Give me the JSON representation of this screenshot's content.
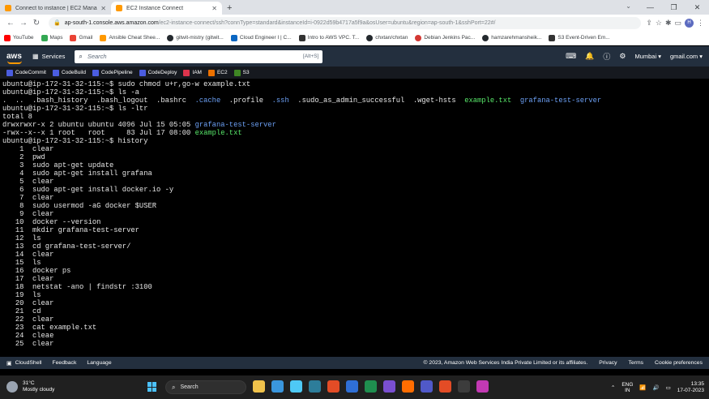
{
  "browser": {
    "tabs": [
      {
        "title": "Connect to instance | EC2 Manag",
        "color": "#ff9900",
        "active": false
      },
      {
        "title": "EC2 Instance Connect",
        "color": "#ff9900",
        "active": true
      }
    ],
    "url_host": "ap-south-1.console.aws.amazon.com",
    "url_path": "/ec2-instance-connect/ssh?connType=standard&instanceId=i-0922d59b4717a5f9a&osUser=ubuntu&region=ap-south-1&sshPort=22#/",
    "profile_initial": "H"
  },
  "bookmarks": [
    {
      "label": "YouTube",
      "color": "#ff0000"
    },
    {
      "label": "Maps",
      "color": "#34a853"
    },
    {
      "label": "Gmail",
      "color": "#ea4335"
    },
    {
      "label": "Ansible Cheat Shee...",
      "color": "#ff9900"
    },
    {
      "label": "gitwit-mistry (gitwit...",
      "color": "#24292e"
    },
    {
      "label": "Cloud Engineer I | C...",
      "color": "#0a66c2"
    },
    {
      "label": "Intro to AWS VPC. T...",
      "color": "#333333"
    },
    {
      "label": "chxtan/chxtan",
      "color": "#24292e"
    },
    {
      "label": "Debian Jenkins Pac...",
      "color": "#d33833"
    },
    {
      "label": "hamzarehmansheik...",
      "color": "#24292e"
    },
    {
      "label": "S3 Event-Driven Em...",
      "color": "#333333"
    }
  ],
  "aws": {
    "services_label": "Services",
    "search_placeholder": "Search",
    "search_shortcut": "[Alt+S]",
    "region": "Mumbai ▾",
    "account": "gmail.com ▾",
    "favorites": [
      {
        "label": "CodeCommit",
        "color": "#4b5de0"
      },
      {
        "label": "CodeBuild",
        "color": "#4b5de0"
      },
      {
        "label": "CodePipeline",
        "color": "#4b5de0"
      },
      {
        "label": "CodeDeploy",
        "color": "#4b5de0"
      },
      {
        "label": "IAM",
        "color": "#dd344c"
      },
      {
        "label": "EC2",
        "color": "#ed7100"
      },
      {
        "label": "S3",
        "color": "#3f8624"
      }
    ]
  },
  "terminal": {
    "lines": [
      [
        {
          "t": "ubuntu@ip-172-31-32-115:~$ sudo chmod u+r,go-w example.txt",
          "c": ""
        }
      ],
      [
        {
          "t": "ubuntu@ip-172-31-32-115:~$ ls -a",
          "c": ""
        }
      ],
      [
        {
          "t": ".  ..  .bash_history  .bash_logout  .bashrc  ",
          "c": ""
        },
        {
          "t": ".cache",
          "c": "dir"
        },
        {
          "t": "  .profile  ",
          "c": ""
        },
        {
          "t": ".ssh",
          "c": "dir"
        },
        {
          "t": "  .sudo_as_admin_successful  .wget-hsts  ",
          "c": ""
        },
        {
          "t": "example.txt",
          "c": "exe"
        },
        {
          "t": "  ",
          "c": ""
        },
        {
          "t": "grafana-test-server",
          "c": "dir"
        }
      ],
      [
        {
          "t": "ubuntu@ip-172-31-32-115:~$ ls -ltr",
          "c": ""
        }
      ],
      [
        {
          "t": "total 8",
          "c": ""
        }
      ],
      [
        {
          "t": "drwxrwxr-x 2 ubuntu ubuntu 4096 Jul 15 05:05 ",
          "c": ""
        },
        {
          "t": "grafana-test-server",
          "c": "dir"
        }
      ],
      [
        {
          "t": "-rwx--x--x 1 root   root     83 Jul 17 08:00 ",
          "c": ""
        },
        {
          "t": "example.txt",
          "c": "exe"
        }
      ],
      [
        {
          "t": "ubuntu@ip-172-31-32-115:~$ history",
          "c": ""
        }
      ],
      [
        {
          "t": "    1  clear",
          "c": ""
        }
      ],
      [
        {
          "t": "    2  pwd",
          "c": ""
        }
      ],
      [
        {
          "t": "    3  sudo apt-get update",
          "c": ""
        }
      ],
      [
        {
          "t": "    4  sudo apt-get install grafana",
          "c": ""
        }
      ],
      [
        {
          "t": "    5  clear",
          "c": ""
        }
      ],
      [
        {
          "t": "    6  sudo apt-get install docker.io -y",
          "c": ""
        }
      ],
      [
        {
          "t": "    7  clear",
          "c": ""
        }
      ],
      [
        {
          "t": "    8  sudo usermod -aG docker $USER",
          "c": ""
        }
      ],
      [
        {
          "t": "    9  clear",
          "c": ""
        }
      ],
      [
        {
          "t": "   10  docker --version",
          "c": ""
        }
      ],
      [
        {
          "t": "   11  mkdir grafana-test-server",
          "c": ""
        }
      ],
      [
        {
          "t": "   12  ls",
          "c": ""
        }
      ],
      [
        {
          "t": "   13  cd grafana-test-server/",
          "c": ""
        }
      ],
      [
        {
          "t": "   14  clear",
          "c": ""
        }
      ],
      [
        {
          "t": "   15  ls",
          "c": ""
        }
      ],
      [
        {
          "t": "   16  docker ps",
          "c": ""
        }
      ],
      [
        {
          "t": "   17  clear",
          "c": ""
        }
      ],
      [
        {
          "t": "   18  netstat -ano | findstr :3100",
          "c": ""
        }
      ],
      [
        {
          "t": "   19  ls",
          "c": ""
        }
      ],
      [
        {
          "t": "   20  clear",
          "c": ""
        }
      ],
      [
        {
          "t": "   21  cd",
          "c": ""
        }
      ],
      [
        {
          "t": "   22  clear",
          "c": ""
        }
      ],
      [
        {
          "t": "   23  cat example.txt",
          "c": ""
        }
      ],
      [
        {
          "t": "   24  cleae",
          "c": ""
        }
      ],
      [
        {
          "t": "   25  clear",
          "c": ""
        }
      ]
    ]
  },
  "footer": {
    "cloudshell": "CloudShell",
    "feedback": "Feedback",
    "language": "Language",
    "copyright": "© 2023, Amazon Web Services India Private Limited or its affiliates.",
    "privacy": "Privacy",
    "terms": "Terms",
    "cookies": "Cookie preferences"
  },
  "taskbar": {
    "temperature": "31°C",
    "weather": "Mostly cloudy",
    "search": "Search",
    "lang1": "ENG",
    "lang2": "IN",
    "time": "13:35",
    "date": "17-07-2023",
    "apps": [
      "#f0c24b",
      "#3a96dd",
      "#4ec9f5",
      "#2d7d9a",
      "#e34c26",
      "#2f6fd6",
      "#1f8f4f",
      "#7a4fd1",
      "#ff6d00",
      "#5059c9",
      "#e34c26",
      "#3c3c3c",
      "#c239b3"
    ]
  }
}
